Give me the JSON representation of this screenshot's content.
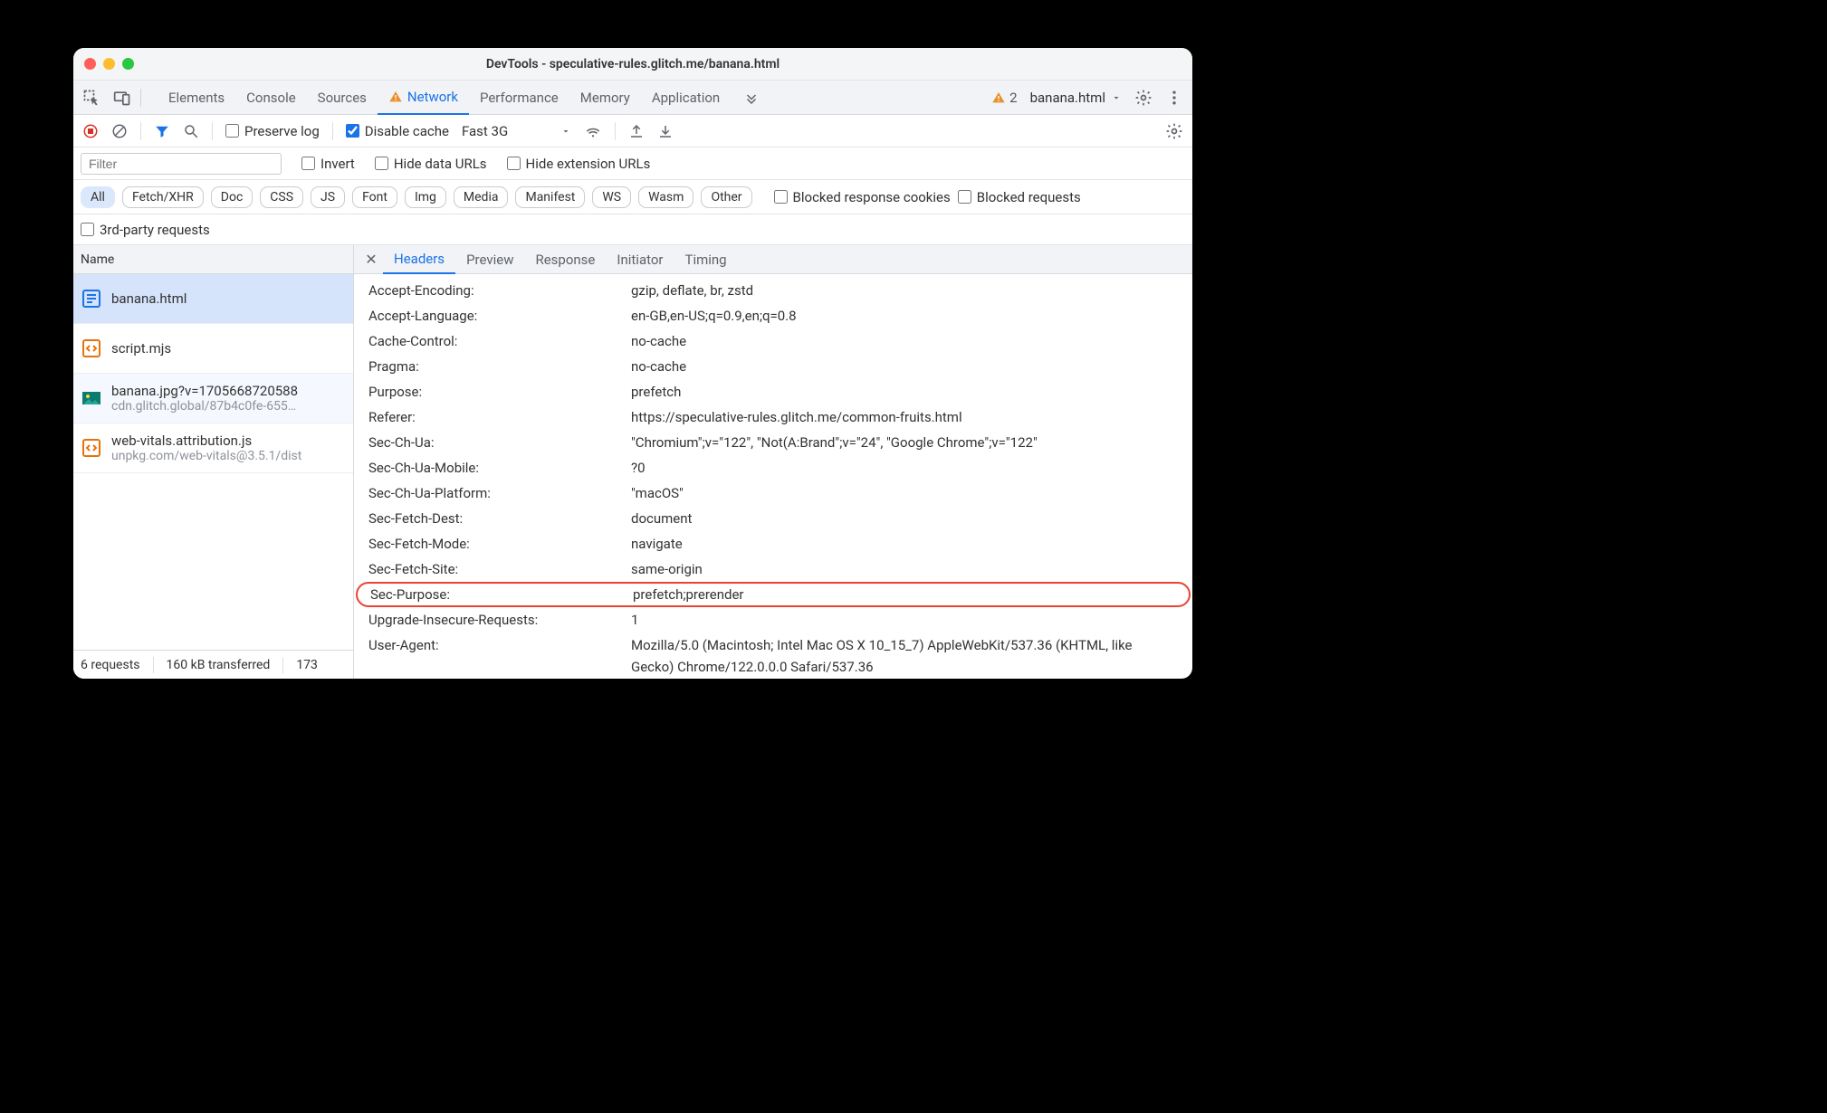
{
  "window": {
    "title": "DevTools - speculative-rules.glitch.me/banana.html"
  },
  "mainTabs": {
    "items": [
      "Elements",
      "Console",
      "Sources",
      "Network",
      "Performance",
      "Memory",
      "Application"
    ],
    "activeIndex": 3,
    "warnings": "2",
    "context": "banana.html"
  },
  "toolbar": {
    "preserveLog": {
      "label": "Preserve log",
      "checked": false
    },
    "disableCache": {
      "label": "Disable cache",
      "checked": true
    },
    "throttling": "Fast 3G"
  },
  "filterRow": {
    "filterPlaceholder": "Filter",
    "invert": {
      "label": "Invert",
      "checked": false
    },
    "hideDataUrls": {
      "label": "Hide data URLs",
      "checked": false
    },
    "hideExtUrls": {
      "label": "Hide extension URLs",
      "checked": false
    }
  },
  "typeFilters": [
    "All",
    "Fetch/XHR",
    "Doc",
    "CSS",
    "JS",
    "Font",
    "Img",
    "Media",
    "Manifest",
    "WS",
    "Wasm",
    "Other"
  ],
  "extraFilters": {
    "blockedRespCookies": {
      "label": "Blocked response cookies",
      "checked": false
    },
    "blockedRequests": {
      "label": "Blocked requests",
      "checked": false
    },
    "thirdParty": {
      "label": "3rd-party requests",
      "checked": false
    }
  },
  "reqList": {
    "nameHeader": "Name",
    "items": [
      {
        "name": "banana.html",
        "sub": "",
        "icon": "doc-blue"
      },
      {
        "name": "script.mjs",
        "sub": "",
        "icon": "code"
      },
      {
        "name": "banana.jpg?v=1705668720588",
        "sub": "cdn.glitch.global/87b4c0fe-655…",
        "icon": "img"
      },
      {
        "name": "web-vitals.attribution.js",
        "sub": "unpkg.com/web-vitals@3.5.1/dist",
        "icon": "code"
      }
    ],
    "selectedIndex": 0
  },
  "status": {
    "requests": "6 requests",
    "transferred": "160 kB transferred",
    "resources": "173"
  },
  "detailTabs": {
    "items": [
      "Headers",
      "Preview",
      "Response",
      "Initiator",
      "Timing"
    ],
    "activeIndex": 0
  },
  "headers": [
    {
      "name": "Accept-Encoding:",
      "value": "gzip, deflate, br, zstd"
    },
    {
      "name": "Accept-Language:",
      "value": "en-GB,en-US;q=0.9,en;q=0.8"
    },
    {
      "name": "Cache-Control:",
      "value": "no-cache"
    },
    {
      "name": "Pragma:",
      "value": "no-cache"
    },
    {
      "name": "Purpose:",
      "value": "prefetch"
    },
    {
      "name": "Referer:",
      "value": "https://speculative-rules.glitch.me/common-fruits.html"
    },
    {
      "name": "Sec-Ch-Ua:",
      "value": "\"Chromium\";v=\"122\", \"Not(A:Brand\";v=\"24\", \"Google Chrome\";v=\"122\""
    },
    {
      "name": "Sec-Ch-Ua-Mobile:",
      "value": "?0"
    },
    {
      "name": "Sec-Ch-Ua-Platform:",
      "value": "\"macOS\""
    },
    {
      "name": "Sec-Fetch-Dest:",
      "value": "document"
    },
    {
      "name": "Sec-Fetch-Mode:",
      "value": "navigate"
    },
    {
      "name": "Sec-Fetch-Site:",
      "value": "same-origin"
    },
    {
      "name": "Sec-Purpose:",
      "value": "prefetch;prerender",
      "highlight": true
    },
    {
      "name": "Upgrade-Insecure-Requests:",
      "value": "1"
    },
    {
      "name": "User-Agent:",
      "value": "Mozilla/5.0 (Macintosh; Intel Mac OS X 10_15_7) AppleWebKit/537.36 (KHTML, like Gecko) Chrome/122.0.0.0 Safari/537.36"
    }
  ]
}
